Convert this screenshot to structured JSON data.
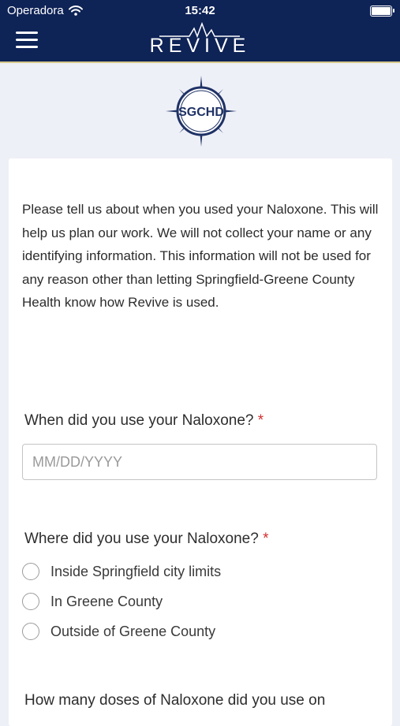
{
  "status_bar": {
    "carrier": "Operadora",
    "time": "15:42"
  },
  "header": {
    "brand": "REVIVE",
    "menu_icon": "hamburger-icon"
  },
  "logo": {
    "text": "SGCHD"
  },
  "form": {
    "intro": "Please tell us about when you used your Naloxone. This will help us plan our work. We will not collect your name or any identifying information. This information will not be used for any reason other than letting Springfield-Greene County Health know how Revive is used.",
    "q1": {
      "label": "When did you use your Naloxone?",
      "required_mark": "*",
      "placeholder": "MM/DD/YYYY",
      "value": ""
    },
    "q2": {
      "label": "Where did you use your Naloxone?",
      "required_mark": "*",
      "options": [
        "Inside Springfield city limits",
        "In Greene County",
        "Outside of Greene County"
      ]
    },
    "q3": {
      "label": "How many doses of Naloxone did you use on"
    }
  },
  "colors": {
    "header_bg": "#0e2356",
    "accent": "#d8c98b",
    "required": "#d32f2f"
  }
}
